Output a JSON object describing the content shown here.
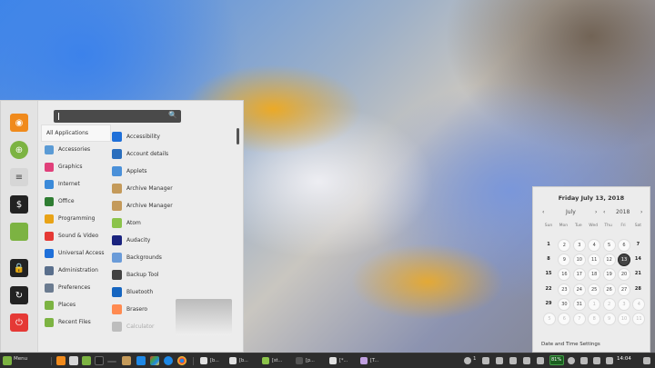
{
  "search": {
    "value": ""
  },
  "categories": [
    {
      "label": "All Applications",
      "color": "#ffffff"
    },
    {
      "label": "Accessories",
      "color": "#5b9bd5"
    },
    {
      "label": "Graphics",
      "color": "#e0407a"
    },
    {
      "label": "Internet",
      "color": "#3b8ad9"
    },
    {
      "label": "Office",
      "color": "#2f7d32"
    },
    {
      "label": "Programming",
      "color": "#e8a317"
    },
    {
      "label": "Sound & Video",
      "color": "#e53935"
    },
    {
      "label": "Universal Access",
      "color": "#1e6fd9"
    },
    {
      "label": "Administration",
      "color": "#5a6f8c"
    },
    {
      "label": "Preferences",
      "color": "#6b7b90"
    },
    {
      "label": "Places",
      "color": "#7cb342"
    },
    {
      "label": "Recent Files",
      "color": "#7cb342"
    }
  ],
  "apps": [
    {
      "label": "Accessibility",
      "color": "#1e6fd9"
    },
    {
      "label": "Account details",
      "color": "#2a6ebd"
    },
    {
      "label": "Applets",
      "color": "#4a90d9"
    },
    {
      "label": "Archive Manager",
      "color": "#c49a5a"
    },
    {
      "label": "Archive Manager",
      "color": "#c49a5a"
    },
    {
      "label": "Atom",
      "color": "#8bc34a"
    },
    {
      "label": "Audacity",
      "color": "#1a237e"
    },
    {
      "label": "Backgrounds",
      "color": "#6a9bd8"
    },
    {
      "label": "Backup Tool",
      "color": "#424242"
    },
    {
      "label": "Bluetooth",
      "color": "#1565c0"
    },
    {
      "label": "Brasero",
      "color": "#ff8a50"
    },
    {
      "label": "Calculator",
      "color": "#bdbdbd"
    }
  ],
  "calendar": {
    "title": "Friday July 13, 2018",
    "month": "July",
    "year": "2018",
    "prev": "‹",
    "next": "›",
    "dows": [
      "Sun",
      "Mon",
      "Tue",
      "Wed",
      "Thu",
      "Fri",
      "Sat"
    ],
    "weeks": [
      [
        "1",
        "2",
        "3",
        "4",
        "5",
        "6",
        "7"
      ],
      [
        "8",
        "9",
        "10",
        "11",
        "12",
        "13",
        "14"
      ],
      [
        "15",
        "16",
        "17",
        "18",
        "19",
        "20",
        "21"
      ],
      [
        "22",
        "23",
        "24",
        "25",
        "26",
        "27",
        "28"
      ],
      [
        "29",
        "30",
        "31",
        "1",
        "2",
        "3",
        "4"
      ],
      [
        "5",
        "6",
        "7",
        "8",
        "9",
        "10",
        "11"
      ]
    ],
    "footer": "Date and Time Settings"
  },
  "panel": {
    "menu_label": "Menu",
    "windows": [
      {
        "label": "[b...",
        "color": "#e0e0e0"
      },
      {
        "label": "[b...",
        "color": "#e0e0e0"
      },
      {
        "label": "[st...",
        "color": "#8bc34a"
      },
      {
        "label": "[p...",
        "color": "#555555"
      },
      {
        "label": "[*...",
        "color": "#e0e0e0"
      },
      {
        "label": "[T...",
        "color": "#c0a0e0"
      }
    ],
    "workspace": "1",
    "battery": "81%",
    "time": "14:04"
  },
  "icons": {
    "search": "magnifier-icon",
    "favorites": [
      "firefox-icon",
      "globe-icon",
      "settings-icon",
      "terminal-icon",
      "folder-icon",
      "lock-icon",
      "logout-icon",
      "power-icon"
    ]
  }
}
